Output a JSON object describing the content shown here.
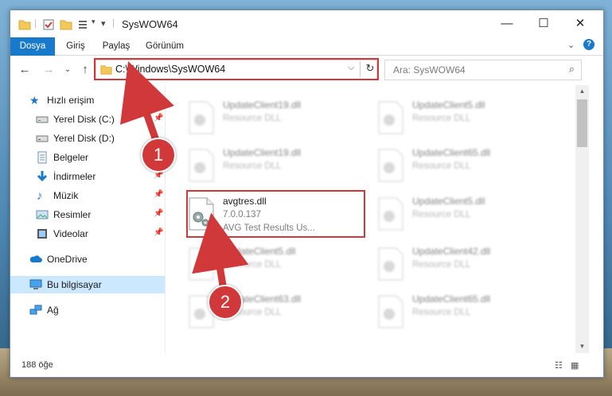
{
  "window": {
    "title": "SysWOW64"
  },
  "ribbon": {
    "tabs": [
      "Dosya",
      "Giriş",
      "Paylaş",
      "Görünüm"
    ]
  },
  "nav": {
    "address": "C:\\Windows\\SysWOW64",
    "search_placeholder": "Ara: SysWOW64"
  },
  "sidebar": {
    "quick_access": "Hızlı erişim",
    "items": [
      {
        "label": "Yerel Disk (C:)",
        "icon": "drive-icon",
        "pinned": true
      },
      {
        "label": "Yerel Disk (D:)",
        "icon": "drive-icon",
        "pinned": false
      },
      {
        "label": "Belgeler",
        "icon": "documents-icon",
        "pinned": true
      },
      {
        "label": "İndirmeler",
        "icon": "downloads-icon",
        "pinned": true
      },
      {
        "label": "Müzik",
        "icon": "music-icon",
        "pinned": true
      },
      {
        "label": "Resimler",
        "icon": "pictures-icon",
        "pinned": true
      },
      {
        "label": "Videolar",
        "icon": "videos-icon",
        "pinned": true
      }
    ],
    "onedrive": "OneDrive",
    "this_pc": "Bu bilgisayar",
    "network": "Ağ"
  },
  "files": {
    "col1": [
      {
        "name": "UpdateClient19.dll",
        "meta1": "Resource DLL"
      },
      {
        "name": "UpdateClient19.dll",
        "meta1": "Resource DLL"
      },
      {
        "name": "avgtres.dll",
        "meta1": "7.0.0.137",
        "meta2": "AVG Test Results Us..."
      },
      {
        "name": "UpdateClient5.dll",
        "meta1": "Resource DLL"
      },
      {
        "name": "UpdateClient63.dll",
        "meta1": "Resource DLL"
      }
    ],
    "col2": [
      {
        "name": "UpdateClient5.dll",
        "meta1": "Resource DLL"
      },
      {
        "name": "UpdateClient65.dll",
        "meta1": "Resource DLL"
      },
      {
        "name": "UpdateClient5.dll",
        "meta1": "Resource DLL"
      },
      {
        "name": "UpdateClient42.dll",
        "meta1": "Resource DLL"
      },
      {
        "name": "UpdateClient65.dll",
        "meta1": "Resource DLL"
      }
    ]
  },
  "status": {
    "count": "188 öğe"
  },
  "annotations": {
    "step1": "1",
    "step2": "2",
    "color": "#d0383a"
  }
}
